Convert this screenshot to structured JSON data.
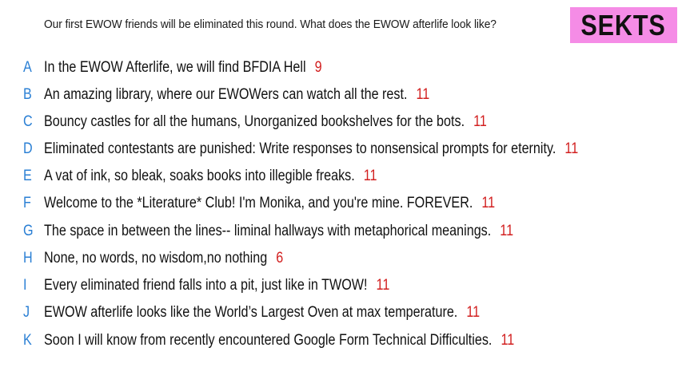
{
  "prompt": "Our first EWOW friends will be eliminated this round. What does the EWOW afterlife look like?",
  "tag": "SEKTS",
  "colors": {
    "letter": "#2a7fd4",
    "count": "#d21f1f",
    "tag_background": "#f58ce6"
  },
  "responses": [
    {
      "letter": "A",
      "text": "In the EWOW Afterlife, we will find BFDIA Hell",
      "count": "9"
    },
    {
      "letter": "B",
      "text": "An amazing library, where our EWOWers can watch all the rest.",
      "count": "11"
    },
    {
      "letter": "C",
      "text": "Bouncy castles for all the humans, Unorganized bookshelves for the bots.",
      "count": "11"
    },
    {
      "letter": "D",
      "text": "Eliminated contestants are punished: Write responses to nonsensical prompts for eternity.",
      "count": "11"
    },
    {
      "letter": "E",
      "text": "A vat of ink, so bleak, soaks books into illegible freaks.",
      "count": "11"
    },
    {
      "letter": "F",
      "text": "Welcome to the *Literature* Club! I'm Monika, and you're mine. FOREVER.",
      "count": "11"
    },
    {
      "letter": "G",
      "text": "The space in between the lines-- liminal hallways with metaphorical meanings.",
      "count": "11"
    },
    {
      "letter": "H",
      "text": "None, no words, no wisdom,no nothing",
      "count": "6"
    },
    {
      "letter": "I",
      "text": "Every eliminated friend falls into a pit, just like in TWOW!",
      "count": "11"
    },
    {
      "letter": "J",
      "text": "EWOW afterlife looks like the World’s Largest Oven at max temperature.",
      "count": "11"
    },
    {
      "letter": "K",
      "text": "Soon I will know from recently encountered Google Form Technical Difficulties.",
      "count": "11"
    }
  ]
}
